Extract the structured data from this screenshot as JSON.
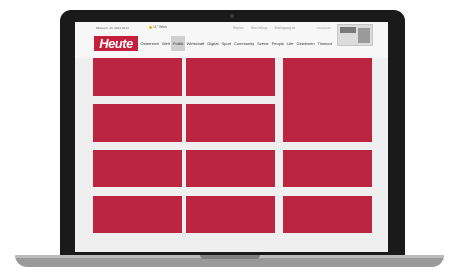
{
  "header": {
    "date": "Mittwoch, 26. März 2014",
    "weather": "11° Wien",
    "partners": [
      "Sterne",
      "WorldCup",
      "Wahlgang.at"
    ],
    "small_link": "INSERIEREN"
  },
  "logo": "Heute",
  "nav": {
    "items": [
      "Österreich",
      "Welt",
      "Politik",
      "Wirtschaft",
      "Digital",
      "Sport",
      "Community",
      "Szene",
      "People",
      "Life",
      "Gewinnen",
      "Timeout"
    ],
    "active": "Politik"
  },
  "content": {
    "tile_color": "#bb2540",
    "tile_count": 11
  }
}
